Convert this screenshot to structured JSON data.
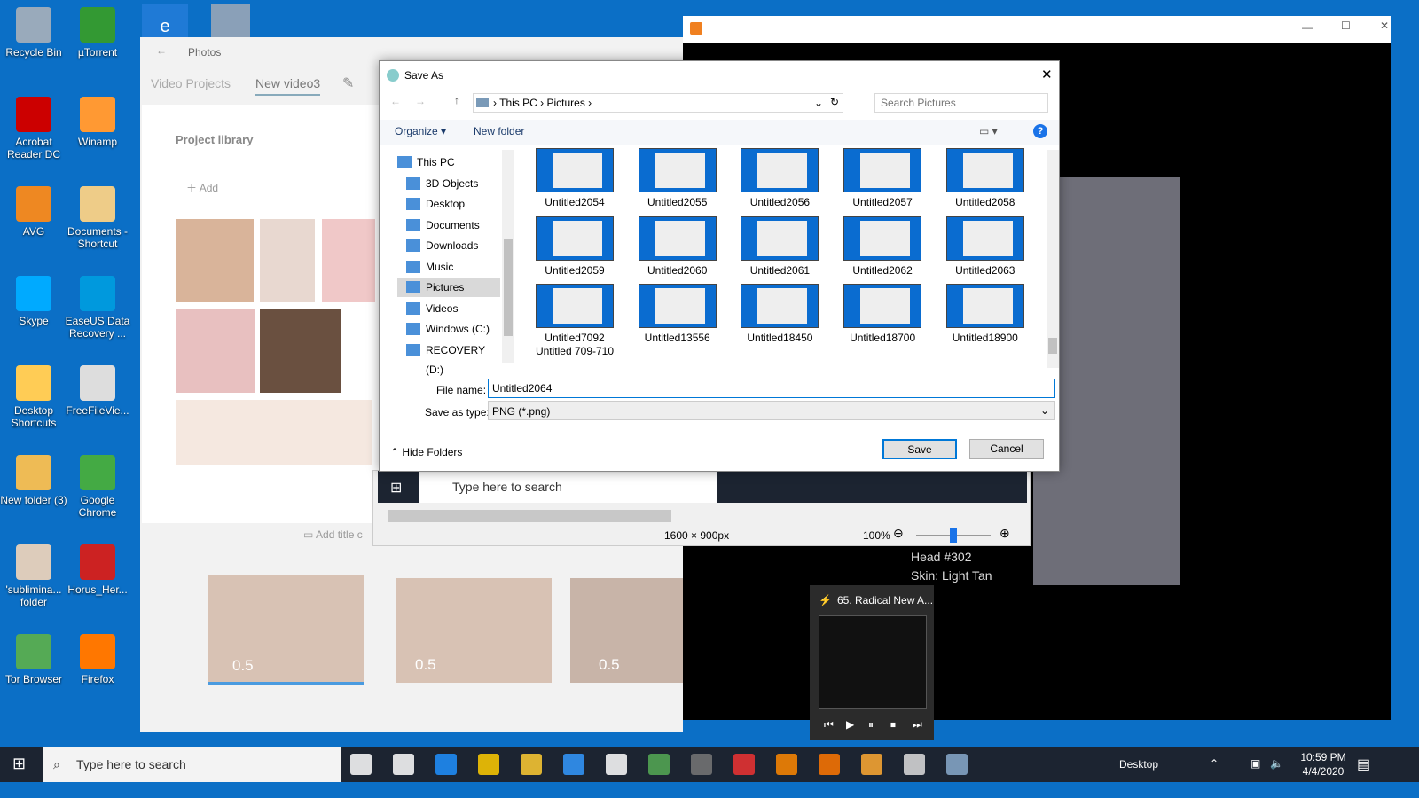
{
  "desktop": {
    "col1": [
      "Recycle Bin",
      "Acrobat Reader DC",
      "AVG",
      "Skype",
      "Desktop Shortcuts",
      "New folder (3)",
      "'sublimina... folder",
      "Tor Browser"
    ],
    "col2": [
      "µTorrent",
      "Winamp",
      "Documents - Shortcut",
      "EaseUS Data Recovery ...",
      "FreeFileVie...",
      "Google Chrome",
      "Horus_Her...",
      "Firefox"
    ]
  },
  "photos": {
    "app": "Photos",
    "breadcrumb": [
      "Video Projects",
      "New video3"
    ],
    "library_title": "Project library",
    "add_label": "Add",
    "add_title": "Add title c",
    "clip_durations": [
      "0.5",
      "0.5",
      "0.5"
    ]
  },
  "dialog": {
    "title": "Save As",
    "path": [
      "This PC",
      "Pictures"
    ],
    "search_placeholder": "Search Pictures",
    "organize": "Organize",
    "new_folder": "New folder",
    "nav": [
      "This PC",
      "3D Objects",
      "Desktop",
      "Documents",
      "Downloads",
      "Music",
      "Pictures",
      "Videos",
      "Windows (C:)",
      "RECOVERY (D:)"
    ],
    "selected_nav": "Pictures",
    "files": [
      "Untitled2054",
      "Untitled2055",
      "Untitled2056",
      "Untitled2057",
      "Untitled2058",
      "Untitled2059",
      "Untitled2060",
      "Untitled2061",
      "Untitled2062",
      "Untitled2063",
      "Untitled7092\nUntitled 709-710",
      "Untitled13556",
      "Untitled18450",
      "Untitled18700",
      "Untitled18900"
    ],
    "file_name_label": "File name:",
    "file_name": "Untitled2064",
    "type_label": "Save as type:",
    "type_value": "PNG (*.png)",
    "hide_folders": "Hide Folders",
    "save": "Save",
    "cancel": "Cancel"
  },
  "viewer": {
    "search": "Type here to search",
    "dimensions": "1600 × 900px",
    "zoom": "100%",
    "zoom_level": 0.5
  },
  "overlay": {
    "line1": "Head #302",
    "line2": "Skin: Light Tan"
  },
  "winamp": {
    "track": "65. Radical New A..."
  },
  "taskbar": {
    "search": "Type here to search",
    "desktop": "Desktop",
    "time": "10:59 PM",
    "date": "4/4/2020"
  }
}
